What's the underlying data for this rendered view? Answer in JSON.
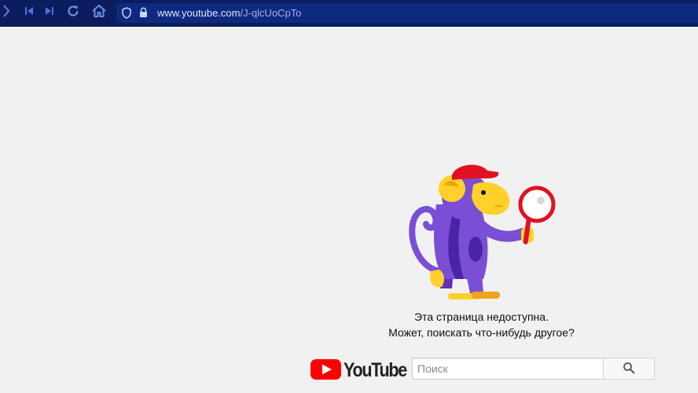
{
  "browser": {
    "url_host": "www.youtube.com",
    "url_path": "/J-qlcUoCpTo",
    "icons": {
      "sidebar": "chevron-right-icon",
      "back": "skip-back-icon",
      "forward": "skip-forward-icon",
      "reload": "reload-icon",
      "home": "home-icon",
      "shield": "shield-icon",
      "lock": "lock-icon"
    },
    "colors": {
      "toolbar": "#0b1d5e",
      "url_bar": "#0e2a80",
      "icon": "#6b8ee8"
    }
  },
  "error_page": {
    "line1": "Эта страница недоступна.",
    "line2": "Может, поискать что-нибудь другое?",
    "illustration": "monkey-with-magnifier"
  },
  "brand": {
    "logo_text": "YouTube",
    "logo_color": "#ff0000"
  },
  "search": {
    "placeholder": "Поиск",
    "value": "",
    "icon": "search-icon"
  }
}
